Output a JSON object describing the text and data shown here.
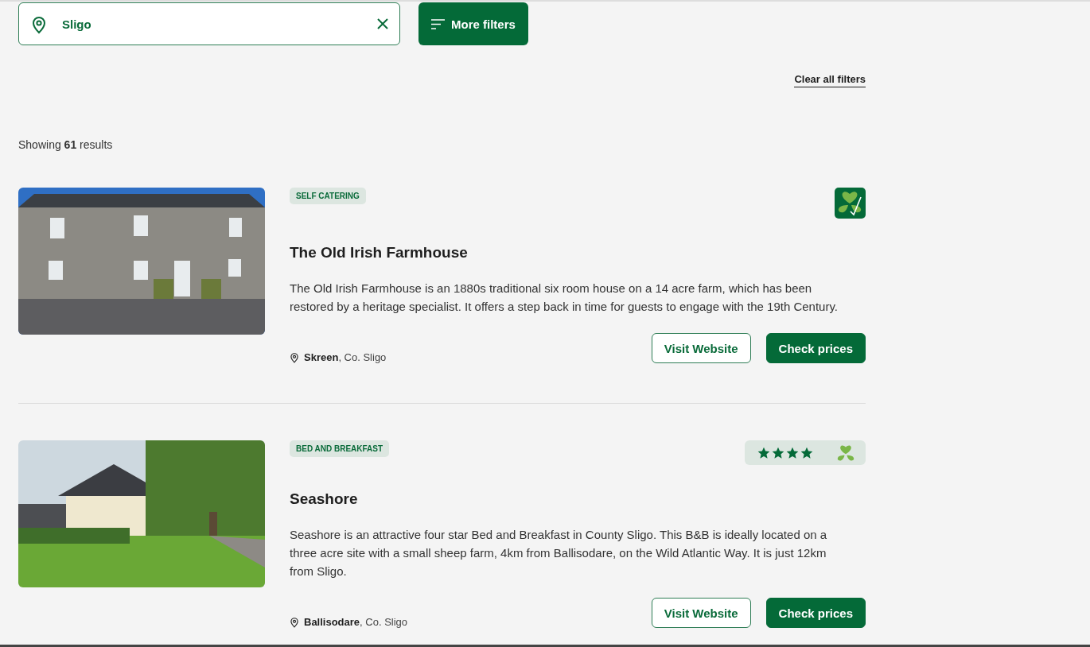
{
  "search": {
    "value": "Sligo"
  },
  "more_filters": {
    "label": "More filters"
  },
  "clear_all": "Clear all filters",
  "results_summary": "Showing **61** results",
  "listings": [
    {
      "tag": "SELF CATERING",
      "rating": {
        "kind": "approved"
      },
      "title": "The Old Irish Farmhouse",
      "description": "The Old Irish Farmhouse is an 1880s traditional six room house on a 14 acre farm, which has been restored by a heritage specialist. It offers a step back in time for guests to engage with the 19th Century.",
      "location": "**Skreen**, Co. Sligo",
      "buttons": [
        "Visit Website",
        "Check prices"
      ]
    },
    {
      "tag": "BED AND BREAKFAST",
      "rating": {
        "kind": "stars",
        "stars": 4
      },
      "title": "Seashore",
      "description": "Seashore is an attractive four star Bed and Breakfast in County Sligo. This B&B is ideally located on a three acre site with a small sheep farm, 4km from Ballisodare, on the Wild Atlantic Way. It is just 12km from Sligo.",
      "location": "**Ballisodare**, Co. Sligo",
      "buttons": [
        "Visit Website",
        "Check prices"
      ]
    }
  ]
}
